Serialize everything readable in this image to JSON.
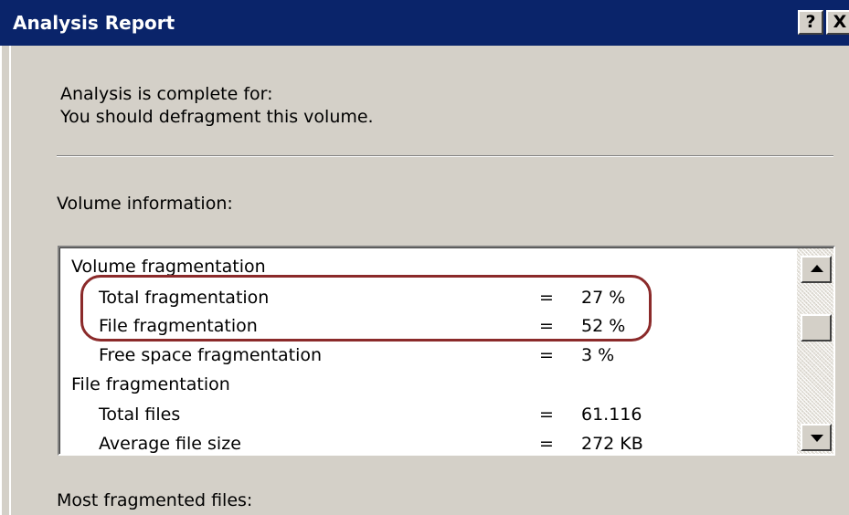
{
  "window": {
    "title": "Analysis Report",
    "help_button": "?",
    "close_button": "X"
  },
  "header": {
    "line1": "Analysis is complete for:",
    "line2": "You should defragment this volume."
  },
  "volume_info_label": "Volume information:",
  "volume_list": {
    "rows": [
      {
        "label": "Volume fragmentation",
        "eq": "",
        "value": ""
      },
      {
        "label": "Total fragmentation",
        "eq": "=",
        "value": "27 %"
      },
      {
        "label": "File fragmentation",
        "eq": "=",
        "value": "52 %"
      },
      {
        "label": "Free space fragmentation",
        "eq": "=",
        "value": "3 %"
      },
      {
        "label": "File fragmentation",
        "eq": "",
        "value": ""
      },
      {
        "label": "Total files",
        "eq": "=",
        "value": "61.116"
      },
      {
        "label": "Average file size",
        "eq": "=",
        "value": "272 KB"
      }
    ]
  },
  "most_fragmented_label": "Most fragmented files:",
  "icons": {
    "scroll_up": "triangle-up-icon",
    "scroll_down": "triangle-down-icon"
  },
  "colors": {
    "titlebar": "#0a246a",
    "highlight": "#8b2a2a",
    "face": "#d4d0c8"
  }
}
